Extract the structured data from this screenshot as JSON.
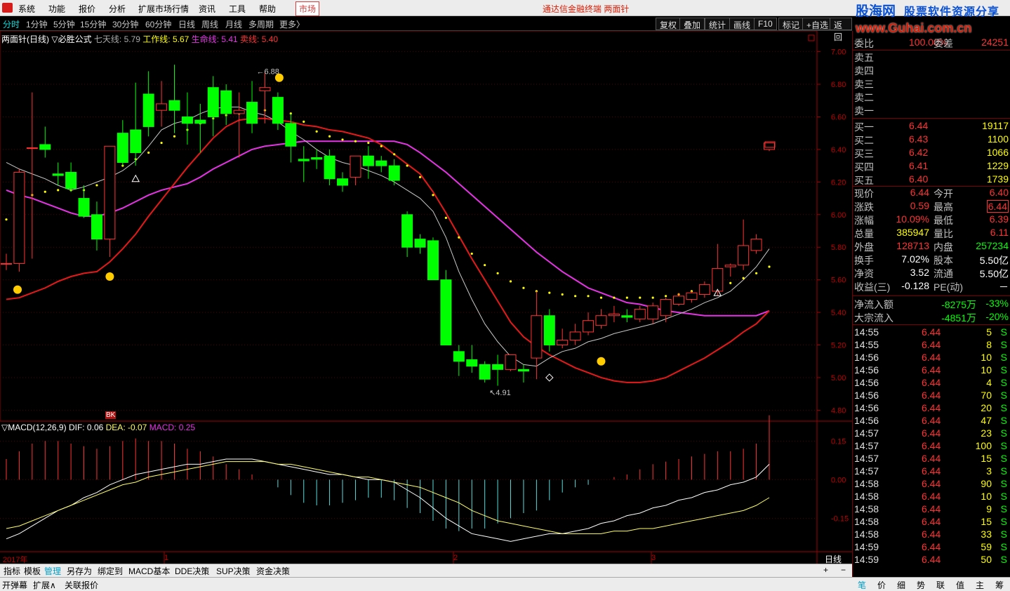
{
  "menu": {
    "items": [
      "系统",
      "功能",
      "报价",
      "分析",
      "扩展市场行情",
      "资讯",
      "工具",
      "帮助"
    ],
    "market": "市场",
    "title": "通达信金融终端  两面针"
  },
  "watermark": {
    "site": "股海网",
    "slogan": "股票软件资源分享",
    "url": "www.Guhai.com.cn"
  },
  "periods": [
    "分时",
    "1分钟",
    "5分钟",
    "15分钟",
    "30分钟",
    "60分钟",
    "日线",
    "周线",
    "月线",
    "多周期",
    "更多〉"
  ],
  "toolbar": [
    "复权",
    "叠加",
    "统计",
    "画线",
    "F10",
    "标记",
    "+自选",
    "返回"
  ],
  "main_legend": {
    "name": "两面针(日线)",
    "formula": "▽必胜公式",
    "l1": "七天线: 5.79",
    "l2": "工作线: 5.67",
    "l3": "生命线: 5.41",
    "l4": "卖线: 5.40"
  },
  "macd_legend": {
    "name": "▽MACD(12,26,9)",
    "dif": "DIF: 0.06",
    "dea": "DEA: -0.07",
    "macd": "MACD: 0.25"
  },
  "price_axis": [
    "7.00",
    "6.80",
    "6.60",
    "6.40",
    "6.20",
    "6.00",
    "5.80",
    "5.60",
    "5.40",
    "5.20",
    "5.00",
    "4.80"
  ],
  "macd_axis": [
    "0.15",
    "0.00",
    "-0.15"
  ],
  "time_axis": {
    "year": "2017年",
    "m1": "1",
    "m2": "2",
    "m3": "3",
    "period": "日线"
  },
  "annotations": {
    "high": "6.88",
    "low": "4.91",
    "mark": "BK"
  },
  "colors": {
    "up": "#ff3232",
    "down": "#00ff00",
    "ma7": "#c8c8c8",
    "work": "#ffff00",
    "life": "#e633e6",
    "sell": "#e61919",
    "dif": "#ffffff",
    "dea": "#ffff66"
  },
  "quote": {
    "wb": {
      "l1": "委比",
      "v1": "100.00%",
      "l2": "委差",
      "v2": "24251"
    },
    "sells": [
      {
        "l": "卖五"
      },
      {
        "l": "卖四"
      },
      {
        "l": "卖三"
      },
      {
        "l": "卖二"
      },
      {
        "l": "卖一"
      }
    ],
    "buys": [
      {
        "l": "买一",
        "p": "6.44",
        "v": "19117"
      },
      {
        "l": "买二",
        "p": "6.43",
        "v": "1100"
      },
      {
        "l": "买三",
        "p": "6.42",
        "v": "1066"
      },
      {
        "l": "买四",
        "p": "6.41",
        "v": "1229"
      },
      {
        "l": "买五",
        "p": "6.40",
        "v": "1739"
      }
    ],
    "stats": [
      {
        "l1": "现价",
        "v1": "6.44",
        "l2": "今开",
        "v2": "6.40"
      },
      {
        "l1": "涨跌",
        "v1": "0.59",
        "l2": "最高",
        "v2": "6.44"
      },
      {
        "l1": "涨幅",
        "v1": "10.09%",
        "l2": "最低",
        "v2": "6.39"
      },
      {
        "l1": "总量",
        "v1": "385947",
        "l2": "量比",
        "v2": "6.11"
      },
      {
        "l1": "外盘",
        "v1": "128713",
        "l2": "内盘",
        "v2": "257234"
      },
      {
        "l1": "换手",
        "v1": "7.02%",
        "l2": "股本",
        "v2": "5.50亿"
      },
      {
        "l1": "净资",
        "v1": "3.52",
        "l2": "流通",
        "v2": "5.50亿"
      },
      {
        "l1": "收益(三)",
        "v1": "-0.128",
        "l2": "PE(动)",
        "v2": "－"
      }
    ],
    "flow": [
      {
        "l": "净流入额",
        "v": "-8275万",
        "p": "-33%"
      },
      {
        "l": "大宗流入",
        "v": "-4851万",
        "p": "-20%"
      }
    ],
    "ticks": [
      {
        "t": "14:55",
        "p": "6.44",
        "v": "5",
        "s": "S"
      },
      {
        "t": "14:55",
        "p": "6.44",
        "v": "8",
        "s": "S"
      },
      {
        "t": "14:56",
        "p": "6.44",
        "v": "10",
        "s": "S"
      },
      {
        "t": "14:56",
        "p": "6.44",
        "v": "10",
        "s": "S"
      },
      {
        "t": "14:56",
        "p": "6.44",
        "v": "4",
        "s": "S"
      },
      {
        "t": "14:56",
        "p": "6.44",
        "v": "70",
        "s": "S"
      },
      {
        "t": "14:56",
        "p": "6.44",
        "v": "20",
        "s": "S"
      },
      {
        "t": "14:56",
        "p": "6.44",
        "v": "47",
        "s": "S"
      },
      {
        "t": "14:57",
        "p": "6.44",
        "v": "23",
        "s": "S"
      },
      {
        "t": "14:57",
        "p": "6.44",
        "v": "100",
        "s": "S"
      },
      {
        "t": "14:57",
        "p": "6.44",
        "v": "15",
        "s": "S"
      },
      {
        "t": "14:57",
        "p": "6.44",
        "v": "3",
        "s": "S"
      },
      {
        "t": "14:58",
        "p": "6.44",
        "v": "90",
        "s": "S"
      },
      {
        "t": "14:58",
        "p": "6.44",
        "v": "10",
        "s": "S"
      },
      {
        "t": "14:58",
        "p": "6.44",
        "v": "9",
        "s": "S"
      },
      {
        "t": "14:58",
        "p": "6.44",
        "v": "15",
        "s": "S"
      },
      {
        "t": "14:58",
        "p": "6.44",
        "v": "33",
        "s": "S"
      },
      {
        "t": "14:59",
        "p": "6.44",
        "v": "59",
        "s": "S"
      },
      {
        "t": "14:59",
        "p": "6.44",
        "v": "50",
        "s": "S"
      }
    ]
  },
  "bottom_tabs": [
    "指标",
    "模板",
    "管理",
    "另存为",
    "绑定到",
    "MACD基本",
    "DDE决策",
    "SUP决策",
    "资金决策"
  ],
  "status": {
    "s1": "开弹幕",
    "s2": "扩展∧",
    "s3": "关联报价"
  },
  "right_tabs": [
    "笔",
    "价",
    "细",
    "势",
    "联",
    "值",
    "主",
    "筹"
  ],
  "chart_data": {
    "type": "candlestick",
    "ylim": [
      4.75,
      7.05
    ],
    "candles": [
      {
        "o": 5.7,
        "h": 5.76,
        "l": 5.66,
        "c": 5.7
      },
      {
        "o": 5.7,
        "h": 6.28,
        "l": 5.65,
        "c": 6.26
      },
      {
        "o": 6.41,
        "h": 6.75,
        "l": 5.73,
        "c": 6.41
      },
      {
        "o": 6.43,
        "h": 6.54,
        "l": 6.35,
        "c": 6.4
      },
      {
        "o": 6.25,
        "h": 6.32,
        "l": 6.18,
        "c": 6.24
      },
      {
        "o": 6.26,
        "h": 6.32,
        "l": 6.14,
        "c": 6.16
      },
      {
        "o": 6.1,
        "h": 6.18,
        "l": 5.98,
        "c": 5.99
      },
      {
        "o": 6.0,
        "h": 6.08,
        "l": 5.78,
        "c": 5.85
      },
      {
        "o": 5.85,
        "h": 6.42,
        "l": 5.74,
        "c": 6.42
      },
      {
        "o": 6.5,
        "h": 6.58,
        "l": 6.3,
        "c": 6.32
      },
      {
        "o": 6.52,
        "h": 6.81,
        "l": 6.3,
        "c": 6.38
      },
      {
        "o": 6.74,
        "h": 6.88,
        "l": 6.48,
        "c": 6.54
      },
      {
        "o": 6.64,
        "h": 6.82,
        "l": 6.54,
        "c": 6.68
      },
      {
        "o": 6.7,
        "h": 6.92,
        "l": 6.5,
        "c": 6.64
      },
      {
        "o": 6.6,
        "h": 6.75,
        "l": 6.43,
        "c": 6.56
      },
      {
        "o": 6.58,
        "h": 6.68,
        "l": 6.38,
        "c": 6.56
      },
      {
        "o": 6.78,
        "h": 6.85,
        "l": 6.48,
        "c": 6.6
      },
      {
        "o": 6.76,
        "h": 6.8,
        "l": 6.55,
        "c": 6.62
      },
      {
        "o": 6.62,
        "h": 6.75,
        "l": 6.35,
        "c": 6.64
      },
      {
        "o": 6.69,
        "h": 6.82,
        "l": 6.5,
        "c": 6.56
      },
      {
        "o": 6.76,
        "h": 6.88,
        "l": 6.56,
        "c": 6.78
      },
      {
        "o": 6.72,
        "h": 6.75,
        "l": 6.52,
        "c": 6.56
      },
      {
        "o": 6.56,
        "h": 6.62,
        "l": 6.32,
        "c": 6.42
      },
      {
        "o": 6.34,
        "h": 6.42,
        "l": 6.2,
        "c": 6.33
      },
      {
        "o": 6.35,
        "h": 6.4,
        "l": 6.28,
        "c": 6.34
      },
      {
        "o": 6.36,
        "h": 6.4,
        "l": 6.18,
        "c": 6.22
      },
      {
        "o": 6.22,
        "h": 6.26,
        "l": 6.14,
        "c": 6.18
      },
      {
        "o": 6.23,
        "h": 6.36,
        "l": 6.18,
        "c": 6.36
      },
      {
        "o": 6.36,
        "h": 6.42,
        "l": 6.22,
        "c": 6.3
      },
      {
        "o": 6.33,
        "h": 6.36,
        "l": 6.26,
        "c": 6.3
      },
      {
        "o": 6.3,
        "h": 6.34,
        "l": 6.18,
        "c": 6.21
      },
      {
        "o": 6.0,
        "h": 6.02,
        "l": 5.74,
        "c": 5.8
      },
      {
        "o": 5.85,
        "h": 5.88,
        "l": 5.76,
        "c": 5.8
      },
      {
        "o": 5.84,
        "h": 5.86,
        "l": 5.6,
        "c": 5.6
      },
      {
        "o": 5.6,
        "h": 5.66,
        "l": 5.2,
        "c": 5.2
      },
      {
        "o": 5.16,
        "h": 5.2,
        "l": 5.01,
        "c": 5.1
      },
      {
        "o": 5.11,
        "h": 5.2,
        "l": 5.03,
        "c": 5.07
      },
      {
        "o": 5.08,
        "h": 5.1,
        "l": 4.97,
        "c": 4.99
      },
      {
        "o": 5.08,
        "h": 5.14,
        "l": 4.95,
        "c": 5.05
      },
      {
        "o": 5.05,
        "h": 5.14,
        "l": 5.04,
        "c": 5.14
      },
      {
        "o": 5.05,
        "h": 5.08,
        "l": 4.97,
        "c": 5.04
      },
      {
        "o": 5.12,
        "h": 5.53,
        "l": 4.99,
        "c": 5.38
      },
      {
        "o": 5.38,
        "h": 5.42,
        "l": 5.16,
        "c": 5.2
      },
      {
        "o": 5.2,
        "h": 5.3,
        "l": 5.18,
        "c": 5.23
      },
      {
        "o": 5.23,
        "h": 5.33,
        "l": 5.2,
        "c": 5.28
      },
      {
        "o": 5.28,
        "h": 5.4,
        "l": 5.26,
        "c": 5.35
      },
      {
        "o": 5.32,
        "h": 5.42,
        "l": 5.3,
        "c": 5.38
      },
      {
        "o": 5.38,
        "h": 5.44,
        "l": 5.34,
        "c": 5.39
      },
      {
        "o": 5.38,
        "h": 5.42,
        "l": 5.34,
        "c": 5.37
      },
      {
        "o": 5.36,
        "h": 5.44,
        "l": 5.34,
        "c": 5.42
      },
      {
        "o": 5.36,
        "h": 5.46,
        "l": 5.33,
        "c": 5.44
      },
      {
        "o": 5.38,
        "h": 5.49,
        "l": 5.34,
        "c": 5.48
      },
      {
        "o": 5.45,
        "h": 5.52,
        "l": 5.44,
        "c": 5.5
      },
      {
        "o": 5.48,
        "h": 5.53,
        "l": 5.46,
        "c": 5.52
      },
      {
        "o": 5.51,
        "h": 5.59,
        "l": 5.49,
        "c": 5.57
      },
      {
        "o": 5.53,
        "h": 5.82,
        "l": 5.5,
        "c": 5.67
      },
      {
        "o": 5.68,
        "h": 5.7,
        "l": 5.62,
        "c": 5.69
      },
      {
        "o": 5.69,
        "h": 5.97,
        "l": 5.66,
        "c": 5.81
      },
      {
        "o": 5.78,
        "h": 5.88,
        "l": 5.76,
        "c": 5.85
      },
      {
        "o": 6.4,
        "h": 6.44,
        "l": 6.39,
        "c": 6.44
      }
    ],
    "ma7": [
      6.32,
      6.28,
      6.25,
      6.22,
      6.18,
      6.15,
      6.17,
      6.2,
      6.23,
      6.27,
      6.33,
      6.42,
      6.52,
      6.56,
      6.58,
      6.62,
      6.65,
      6.66,
      6.66,
      6.63,
      6.61,
      6.57,
      6.51,
      6.46,
      6.4,
      6.35,
      6.32,
      6.3,
      6.27,
      6.24,
      6.2,
      6.15,
      6.1,
      6.02,
      5.86,
      5.65,
      5.48,
      5.33,
      5.22,
      5.13,
      5.08,
      5.07,
      5.12,
      5.16,
      5.18,
      5.22,
      5.24,
      5.27,
      5.29,
      5.31,
      5.33,
      5.36,
      5.39,
      5.42,
      5.46,
      5.49,
      5.53,
      5.6,
      5.68,
      5.79
    ],
    "work": [
      5.91,
      6.02,
      6.06,
      6.08,
      6.09,
      6.09,
      6.09,
      6.12,
      6.18,
      6.24,
      6.28,
      6.32,
      6.38,
      6.42,
      6.46,
      6.5,
      6.53,
      6.55,
      6.56,
      6.57,
      6.58,
      6.58,
      6.56,
      6.51,
      6.45,
      6.42,
      6.4,
      6.39,
      6.38,
      6.36,
      6.31,
      6.24,
      6.17,
      6.06,
      5.92,
      5.8,
      5.7,
      5.63,
      5.58,
      5.53,
      5.49,
      5.47,
      5.46,
      5.45,
      5.44,
      5.44,
      5.43,
      5.43,
      5.43,
      5.43,
      5.43,
      5.44,
      5.45,
      5.47,
      5.48,
      5.5,
      5.52,
      5.55,
      5.58,
      5.62
    ],
    "life": [
      6.15,
      6.12,
      6.1,
      6.07,
      6.04,
      6.01,
      5.99,
      5.99,
      6.01,
      6.04,
      6.08,
      6.12,
      6.15,
      6.17,
      6.19,
      6.23,
      6.28,
      6.32,
      6.36,
      6.4,
      6.42,
      6.43,
      6.44,
      6.45,
      6.45,
      6.45,
      6.45,
      6.45,
      6.45,
      6.45,
      6.45,
      6.43,
      6.38,
      6.32,
      6.26,
      6.19,
      6.12,
      6.05,
      5.98,
      5.91,
      5.84,
      5.77,
      5.71,
      5.65,
      5.6,
      5.55,
      5.52,
      5.49,
      5.46,
      5.45,
      5.43,
      5.41,
      5.4,
      5.39,
      5.38,
      5.38,
      5.38,
      5.38,
      5.38,
      5.41
    ],
    "sell": [
      5.48,
      5.49,
      5.52,
      5.55,
      5.59,
      5.62,
      5.64,
      5.65,
      5.71,
      5.79,
      5.88,
      5.99,
      6.09,
      6.19,
      6.29,
      6.38,
      6.47,
      6.54,
      6.58,
      6.59,
      6.59,
      6.58,
      6.57,
      6.55,
      6.54,
      6.52,
      6.51,
      6.49,
      6.47,
      6.43,
      6.37,
      6.31,
      6.25,
      6.14,
      6.01,
      5.87,
      5.73,
      5.6,
      5.47,
      5.34,
      5.25,
      5.19,
      5.14,
      5.1,
      5.06,
      5.03,
      5.0,
      4.98,
      4.97,
      4.97,
      4.98,
      5.0,
      5.04,
      5.08,
      5.12,
      5.17,
      5.22,
      5.28,
      5.33,
      5.41
    ],
    "macd_ylim": [
      -0.28,
      0.2
    ],
    "macd_hist": [
      0.08,
      0.11,
      0.14,
      0.15,
      0.15,
      0.14,
      0.13,
      0.12,
      0.13,
      0.15,
      0.16,
      0.15,
      0.15,
      0.14,
      0.12,
      0.11,
      0.09,
      0.06,
      0.04,
      0.02,
      0.0,
      -0.03,
      -0.06,
      -0.09,
      -0.1,
      -0.1,
      -0.09,
      -0.08,
      -0.07,
      -0.07,
      -0.08,
      -0.11,
      -0.13,
      -0.16,
      -0.19,
      -0.2,
      -0.19,
      -0.19,
      -0.17,
      -0.15,
      -0.13,
      -0.12,
      -0.08,
      -0.05,
      -0.03,
      -0.02,
      0.0,
      0.01,
      0.02,
      0.04,
      0.06,
      0.07,
      0.08,
      0.09,
      0.1,
      0.11,
      0.11,
      0.12,
      0.14,
      0.25
    ],
    "dif": [
      -0.23,
      -0.21,
      -0.18,
      -0.15,
      -0.12,
      -0.1,
      -0.07,
      -0.05,
      -0.02,
      0.0,
      0.02,
      0.03,
      0.04,
      0.05,
      0.06,
      0.06,
      0.07,
      0.08,
      0.08,
      0.08,
      0.07,
      0.06,
      0.05,
      0.04,
      0.03,
      0.02,
      0.02,
      0.01,
      0.0,
      0.0,
      -0.01,
      -0.04,
      -0.07,
      -0.11,
      -0.15,
      -0.18,
      -0.21,
      -0.22,
      -0.23,
      -0.24,
      -0.23,
      -0.22,
      -0.21,
      -0.21,
      -0.2,
      -0.19,
      -0.17,
      -0.16,
      -0.14,
      -0.13,
      -0.11,
      -0.1,
      -0.08,
      -0.07,
      -0.05,
      -0.04,
      -0.02,
      -0.01,
      0.01,
      0.06
    ],
    "dea": [
      -0.19,
      -0.18,
      -0.16,
      -0.14,
      -0.12,
      -0.1,
      -0.08,
      -0.06,
      -0.04,
      -0.02,
      -0.01,
      0.01,
      0.02,
      0.03,
      0.04,
      0.05,
      0.06,
      0.07,
      0.07,
      0.07,
      0.07,
      0.06,
      0.06,
      0.05,
      0.04,
      0.03,
      0.02,
      0.01,
      0.01,
      0.0,
      -0.01,
      -0.02,
      -0.03,
      -0.05,
      -0.07,
      -0.09,
      -0.12,
      -0.14,
      -0.16,
      -0.17,
      -0.18,
      -0.19,
      -0.2,
      -0.21,
      -0.21,
      -0.21,
      -0.21,
      -0.2,
      -0.2,
      -0.19,
      -0.19,
      -0.18,
      -0.17,
      -0.16,
      -0.15,
      -0.14,
      -0.13,
      -0.12,
      -0.1,
      -0.07
    ]
  }
}
